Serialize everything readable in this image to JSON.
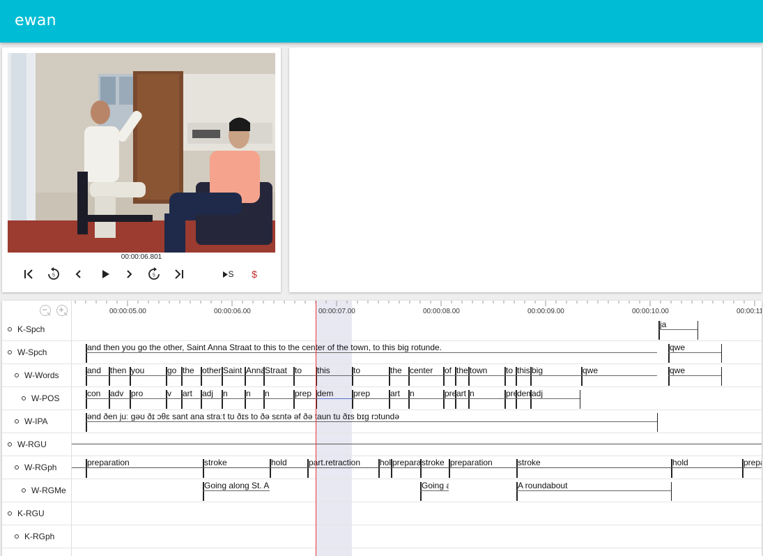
{
  "app": {
    "title": "ewan"
  },
  "player": {
    "timecode": "00:00:06.801",
    "controls": {
      "speed_label": "S",
      "dollar_label": "$"
    }
  },
  "timeline": {
    "ruler_labels": [
      "00:00:05.00",
      "00:00:06.00",
      "00:00:07.00",
      "00:00:08.00",
      "00:00:09.00",
      "00:00:10.00",
      "00:00:11"
    ],
    "tiers": [
      {
        "name": "K-Spch",
        "indent": 0
      },
      {
        "name": "W-Spch",
        "indent": 0
      },
      {
        "name": "W-Words",
        "indent": 1
      },
      {
        "name": "W-POS",
        "indent": 2
      },
      {
        "name": "W-IPA",
        "indent": 1
      },
      {
        "name": "W-RGU",
        "indent": 0
      },
      {
        "name": "W-RGph",
        "indent": 1
      },
      {
        "name": "W-RGMe",
        "indent": 2
      },
      {
        "name": "K-RGU",
        "indent": 0
      },
      {
        "name": "K-RGph",
        "indent": 1
      }
    ],
    "segments": {
      "K-Spch": [
        "ja"
      ],
      "W-Spch": [
        "and then you go the other, Saint Anna Straat to this to the center of the town, to this big rotunde.",
        "qwe"
      ],
      "W-Words": [
        "and",
        "then",
        "you",
        "go",
        "the",
        "other",
        "Saint",
        "Anna",
        "Straat",
        "to",
        "this",
        "to",
        "the",
        "center",
        "of",
        "the",
        "town",
        "to",
        "this",
        "big",
        "qwe",
        "qwe"
      ],
      "W-POS": [
        "con",
        "adv",
        "pro",
        "v",
        "art",
        "adj",
        "n",
        "n",
        "n",
        "prep",
        "dem",
        "prep",
        "art",
        "n",
        "prep",
        "art",
        "n",
        "prep",
        "dem",
        "adj"
      ],
      "W-IPA": [
        "ənd ðen juː gəʊ ðɪ ɔθɛ sant ana straːt tʊ ðɪs to ðə sɛntə əf ðə taun tu ðɪs bɪɡ rɔtundə"
      ],
      "W-RGph": [
        "preparation",
        "stroke",
        "hold",
        "part.retraction",
        "hold",
        "preparation",
        "stroke",
        "preparation",
        "stroke",
        "hold",
        "preparation"
      ],
      "W-RGMe": [
        "Going along St. Anna Straat",
        "Going along",
        "A roundabout"
      ]
    }
  }
}
